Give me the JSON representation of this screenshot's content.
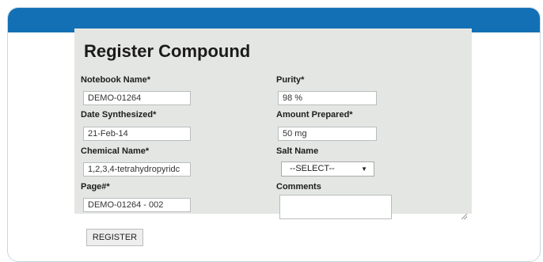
{
  "form": {
    "title": "Register Compound",
    "notebook_name": {
      "label": "Notebook Name*",
      "value": "DEMO-01264"
    },
    "date_synthesized": {
      "label": "Date Synthesized*",
      "value": "21-Feb-14"
    },
    "chemical_name": {
      "label": "Chemical Name*",
      "value": "1,2,3,4-tetrahydropyridc"
    },
    "page_number": {
      "label": "Page#*",
      "value": "DEMO-01264 - 002"
    },
    "purity": {
      "label": "Purity*",
      "value": "98 %"
    },
    "amount_prepared": {
      "label": "Amount Prepared*",
      "value": "50 mg"
    },
    "salt_name": {
      "label": "Salt Name",
      "selected": "--SELECT--"
    },
    "comments": {
      "label": "Comments",
      "value": ""
    },
    "register_label": "REGISTER"
  },
  "colors": {
    "titlebar": "#1470b5",
    "panel": "#e4e6e3"
  },
  "icons": {
    "select_arrow": "triangle-down-icon",
    "resize": "resize-grip-icon"
  }
}
